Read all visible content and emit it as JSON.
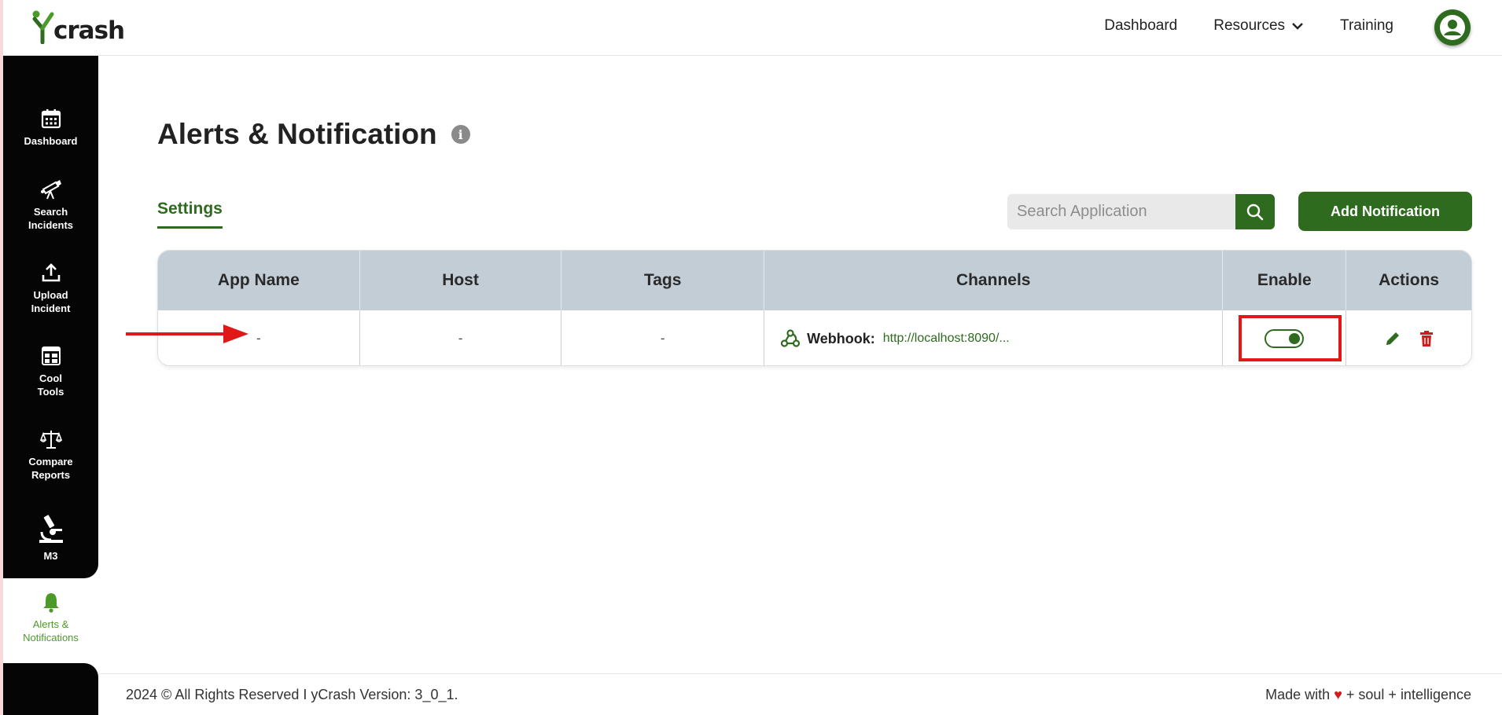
{
  "app": {
    "logo_text": "crash"
  },
  "header": {
    "nav": [
      {
        "label": "Dashboard"
      },
      {
        "label": "Resources"
      },
      {
        "label": "Training"
      }
    ]
  },
  "sidebar": {
    "items": [
      {
        "line1": "Dashboard",
        "line2": "",
        "icon": "calendar-icon"
      },
      {
        "line1": "Search",
        "line2": "Incidents",
        "icon": "telescope-icon"
      },
      {
        "line1": "Upload",
        "line2": "Incident",
        "icon": "upload-icon"
      },
      {
        "line1": "Cool",
        "line2": "Tools",
        "icon": "tools-grid-icon"
      },
      {
        "line1": "Compare",
        "line2": "Reports",
        "icon": "scale-icon"
      },
      {
        "line1": "M3",
        "line2": "",
        "icon": "microscope-icon"
      }
    ],
    "active": {
      "line1": "Alerts &",
      "line2": "Notifications",
      "icon": "bell-icon"
    }
  },
  "main": {
    "title": "Alerts & Notification",
    "info_glyph": "i",
    "tab": "Settings",
    "search_placeholder": "Search Application",
    "add_button": "Add Notification"
  },
  "table": {
    "headers": [
      "App Name",
      "Host",
      "Tags",
      "Channels",
      "Enable",
      "Actions"
    ],
    "rows": [
      {
        "app_name": "-",
        "host": "-",
        "tags": "-",
        "channel_label": "Webhook:",
        "channel_url": "http://localhost:8090/...",
        "enabled": true
      }
    ]
  },
  "footer": {
    "left": "2024 © All Rights Reserved I  yCrash Version: 3_0_1.",
    "right_prefix": "Made with ",
    "heart": "♥",
    "right_suffix": "+ soul + intelligence"
  },
  "colors": {
    "brand_green": "#2e6b1f",
    "active_green": "#4c9a2a",
    "header_gray": "#c2cdd6",
    "annotation_red": "#e01818"
  }
}
